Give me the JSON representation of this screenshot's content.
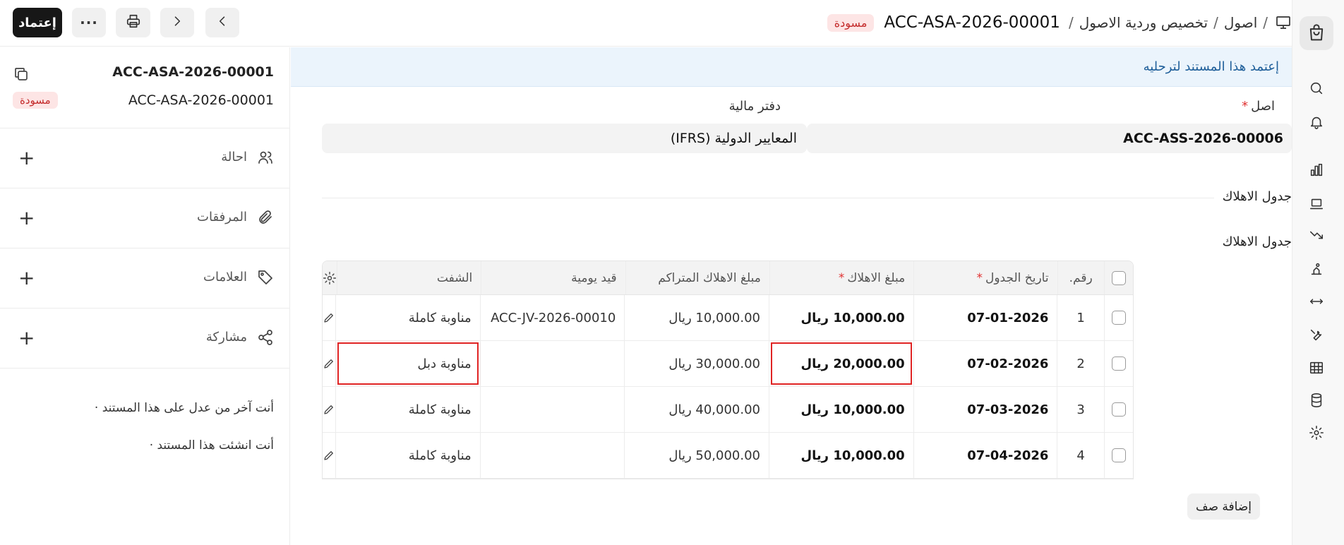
{
  "header": {
    "breadcrumb": [
      "اصول",
      "تخصيص وردية الاصول"
    ],
    "doc_title": "ACC-ASA-2026-00001",
    "status": "مسودة",
    "submit_label": "إعتماد"
  },
  "sidebar": {
    "doc_name": "ACC-ASA-2026-00001",
    "doc_id": "ACC-ASA-2026-00001",
    "status": "مسودة",
    "items": [
      {
        "label": "احالة",
        "icon": "users-icon"
      },
      {
        "label": "المرفقات",
        "icon": "paperclip-icon"
      },
      {
        "label": "العلامات",
        "icon": "tag-icon"
      },
      {
        "label": "مشاركة",
        "icon": "share-icon"
      }
    ],
    "activity": [
      "أنت آخر من عدل على هذا المستند ·",
      "أنت انشئت هذا المستند ·"
    ]
  },
  "main": {
    "alert": "إعتمد هذا المستند لترحليه",
    "asset_label": "اصل",
    "asset_value": "ACC-ASS-2026-00006",
    "finance_book_label": "دفتر مالية",
    "finance_book_value": "المعايير الدولية (IFRS)",
    "section_title": "جدول الاهلاك",
    "table_title": "جدول الاهلاك",
    "columns": {
      "idx": "رقم.",
      "date": "تاريخ الجدول",
      "amount": "مبلغ الاهلاك",
      "accumulated": "مبلغ الاهلاك المتراكم",
      "journal": "قيد يومية",
      "shift": "الشفت"
    },
    "rows": [
      {
        "idx": "1",
        "date": "07-01-2026",
        "amount": "10,000.00 ريال",
        "accumulated": "10,000.00 ريال",
        "journal": "ACC-JV-2026-00010",
        "shift": "مناوبة كاملة"
      },
      {
        "idx": "2",
        "date": "07-02-2026",
        "amount": "20,000.00 ريال",
        "accumulated": "30,000.00 ريال",
        "journal": "",
        "shift": "مناوبة دبل"
      },
      {
        "idx": "3",
        "date": "07-03-2026",
        "amount": "10,000.00 ريال",
        "accumulated": "40,000.00 ريال",
        "journal": "",
        "shift": "مناوبة كاملة"
      },
      {
        "idx": "4",
        "date": "07-04-2026",
        "amount": "10,000.00 ريال",
        "accumulated": "50,000.00 ريال",
        "journal": "",
        "shift": "مناوبة كاملة"
      }
    ],
    "add_row_label": "إضافة صف"
  },
  "colors": {
    "accent": "#171717",
    "draft_bg": "#fde5e5",
    "draft_text": "#c42b2b",
    "alert_bg": "#ebf4fc",
    "highlight": "#e02424"
  }
}
